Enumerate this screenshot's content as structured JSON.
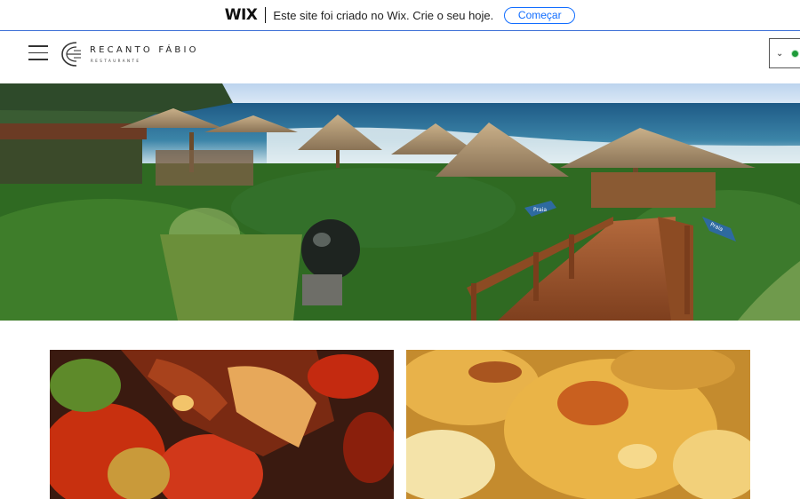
{
  "wix_banner": {
    "logo": "WIX",
    "message": "Este site foi criado no Wix. Crie o seu hoje.",
    "cta_label": "Começar"
  },
  "header": {
    "brand_name": "RECANTO FÁBIO",
    "brand_sub": "RESTAURANTE",
    "menu_icon": "hamburger-icon",
    "lang_icon": "chevron-down-icon"
  },
  "hero": {
    "signs": [
      "Praia",
      "Praia"
    ]
  },
  "colors": {
    "wix_blue": "#116dff",
    "banner_border": "#3b6fd6",
    "flag_green": "#1f9b3a"
  }
}
